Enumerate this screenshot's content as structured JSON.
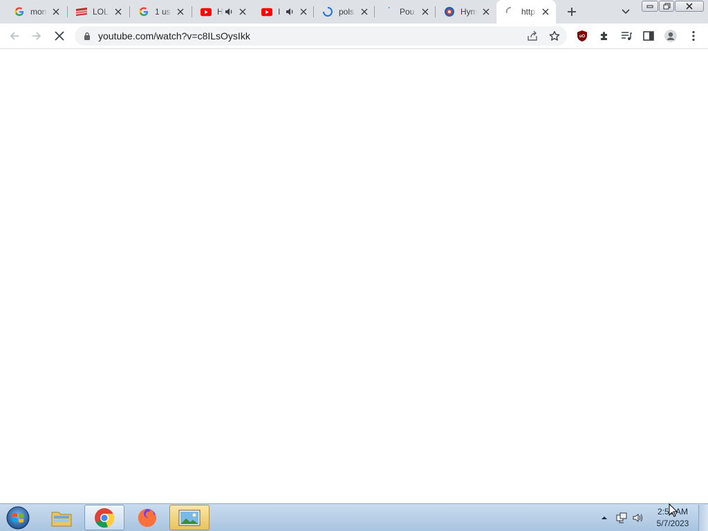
{
  "browser": {
    "tabs": [
      {
        "title": "mon",
        "favicon": "google-icon",
        "audio": false,
        "active": false
      },
      {
        "title": "LOL",
        "favicon": "lol-icon",
        "audio": false,
        "active": false
      },
      {
        "title": "1 us",
        "favicon": "google-icon",
        "audio": false,
        "active": false
      },
      {
        "title": "H",
        "favicon": "youtube-icon",
        "audio": true,
        "active": false
      },
      {
        "title": "I",
        "favicon": "youtube-icon",
        "audio": true,
        "active": false
      },
      {
        "title": "pols",
        "favicon": "loading-spinner-icon",
        "audio": false,
        "active": false
      },
      {
        "title": "Pou",
        "favicon": "loading-spinner-icon",
        "audio": false,
        "active": false
      },
      {
        "title": "Hym",
        "favicon": "site-icon",
        "audio": false,
        "active": false
      },
      {
        "title": "http",
        "favicon": "loading-spinner-icon",
        "audio": false,
        "active": true
      }
    ],
    "address": {
      "url": "youtube.com/watch?v=c8ILsOysIkk"
    }
  },
  "taskbar": {
    "apps": [
      "windows-explorer",
      "google-chrome",
      "firefox",
      "photo-viewer"
    ],
    "clock": {
      "time": "2:59 AM",
      "date": "5/7/2023"
    }
  },
  "colors": {
    "tabstrip": "#dee1e6",
    "omnibox": "#f1f3f4",
    "ublock": "#800000",
    "youtube": "#ff0000",
    "taskbar": "#b6cde6"
  }
}
